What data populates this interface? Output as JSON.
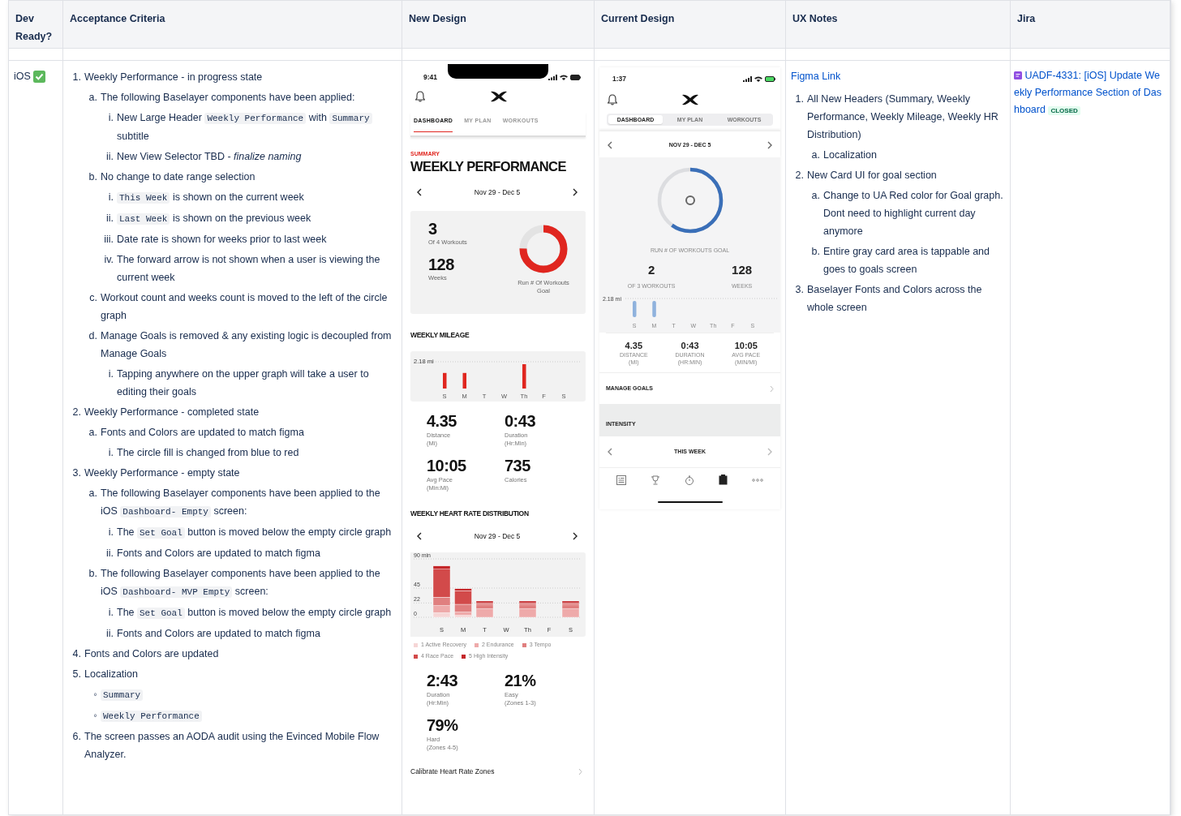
{
  "table": {
    "columns": [
      "Dev Ready?",
      "Acceptance Criteria",
      "New Design",
      "Current Design",
      "UX Notes",
      "Jira"
    ],
    "row": {
      "platform": "iOS",
      "ready": true,
      "criteria": [
        {
          "marker": "1.",
          "text": "Weekly Performance - in progress state",
          "children": [
            {
              "marker": "a.",
              "text": "The following Baselayer components have been applied:",
              "children": [
                {
                  "marker": "i.",
                  "parts": [
                    {
                      "kind": "plain",
                      "text": "New Large Header "
                    },
                    {
                      "kind": "code",
                      "text": "Weekly Performance"
                    },
                    {
                      "kind": "plain",
                      "text": " with "
                    },
                    {
                      "kind": "code",
                      "text": "Summary"
                    },
                    {
                      "kind": "plain",
                      "text": " subtitle"
                    }
                  ]
                },
                {
                  "marker": "ii.",
                  "parts": [
                    {
                      "kind": "plain",
                      "text": "New View Selector TBD -  "
                    },
                    {
                      "kind": "italic",
                      "text": "finalize naming"
                    }
                  ]
                }
              ]
            },
            {
              "marker": "b.",
              "text": "No change to date range selection",
              "children": [
                {
                  "marker": "i.",
                  "parts": [
                    {
                      "kind": "code",
                      "text": "This Week"
                    },
                    {
                      "kind": "plain",
                      "text": " is shown on the current week"
                    }
                  ]
                },
                {
                  "marker": "ii.",
                  "parts": [
                    {
                      "kind": "code",
                      "text": "Last Week"
                    },
                    {
                      "kind": "plain",
                      "text": " is shown on the previous week"
                    }
                  ]
                },
                {
                  "marker": "iii.",
                  "text": "Date rate is shown for weeks prior to last week"
                },
                {
                  "marker": "iv.",
                  "text": "The forward arrow is not shown when a user is viewing the current week"
                }
              ]
            },
            {
              "marker": "c.",
              "text": "Workout count and weeks count is moved to the left of the circle graph"
            },
            {
              "marker": "d.",
              "text": "Manage Goals is removed & any existing logic is decoupled from Manage Goals",
              "children": [
                {
                  "marker": "i.",
                  "text": "Tapping anywhere on the upper graph will take a user to editing their goals"
                }
              ]
            }
          ]
        },
        {
          "marker": "2.",
          "text": "Weekly Performance - completed state",
          "children": [
            {
              "marker": "a.",
              "text": "Fonts and Colors are updated to match figma",
              "children": [
                {
                  "marker": "i.",
                  "text": "The circle fill is changed from blue to red"
                }
              ]
            }
          ]
        },
        {
          "marker": "3.",
          "text": "Weekly Performance - empty state",
          "children": [
            {
              "marker": "a.",
              "parts": [
                {
                  "kind": "plain",
                  "text": "The following Baselayer components have been applied to the iOS "
                },
                {
                  "kind": "code",
                  "text": "Dashboard- Empty"
                },
                {
                  "kind": "plain",
                  "text": " screen:"
                }
              ],
              "children": [
                {
                  "marker": "i.",
                  "parts": [
                    {
                      "kind": "plain",
                      "text": "The "
                    },
                    {
                      "kind": "code",
                      "text": "Set Goal"
                    },
                    {
                      "kind": "plain",
                      "text": " button is moved below the empty circle graph"
                    }
                  ]
                },
                {
                  "marker": "ii.",
                  "text": "Fonts and Colors are updated to match figma"
                }
              ]
            },
            {
              "marker": "b.",
              "parts": [
                {
                  "kind": "plain",
                  "text": "The following Baselayer components have been applied to the iOS "
                },
                {
                  "kind": "code",
                  "text": "Dashboard- MVP Empty"
                },
                {
                  "kind": "plain",
                  "text": " screen:"
                }
              ],
              "children": [
                {
                  "marker": "i.",
                  "parts": [
                    {
                      "kind": "plain",
                      "text": "The "
                    },
                    {
                      "kind": "code",
                      "text": "Set Goal"
                    },
                    {
                      "kind": "plain",
                      "text": " button is moved below the empty circle graph"
                    }
                  ]
                },
                {
                  "marker": "ii.",
                  "text": "Fonts and Colors are updated to match figma"
                }
              ]
            }
          ]
        },
        {
          "marker": "4.",
          "text": "Fonts and Colors are updated"
        },
        {
          "marker": "5.",
          "text": "Localization",
          "children": [
            {
              "marker": "◦",
              "parts": [
                {
                  "kind": "code",
                  "text": "Summary"
                }
              ]
            },
            {
              "marker": "◦",
              "parts": [
                {
                  "kind": "code",
                  "text": "Weekly Performance"
                }
              ]
            }
          ]
        },
        {
          "marker": "6.",
          "text": "The screen passes an AODA audit using the Evinced Mobile Flow Analyzer."
        }
      ],
      "new_design": {
        "time": "9:41",
        "tabs": [
          {
            "label": "DASHBOARD",
            "selected": true
          },
          {
            "label": "MY PLAN",
            "selected": false
          },
          {
            "label": "WORKOUTS",
            "selected": false
          }
        ],
        "eyebrow": "SUMMARY",
        "title": "WEEKLY PERFORMANCE",
        "date_range": "Nov 29 - Dec 5",
        "goal": {
          "stats": [
            {
              "value": "3",
              "label": "Of 4 Workouts"
            },
            {
              "value": "128",
              "label": "Weeks"
            }
          ],
          "level": 0.75,
          "caption": "Run # Of Workouts Goal"
        },
        "mileage": {
          "title": "WEEKLY MILEAGE",
          "axis_label": "2.18 mi",
          "days": [
            "S",
            "M",
            "T",
            "W",
            "Th",
            "F",
            "S"
          ]
        },
        "stats": [
          {
            "value": "4.35",
            "label": "Distance",
            "unit": "(Mi)"
          },
          {
            "value": "0:43",
            "label": "Duration",
            "unit": "(Hr:Min)"
          },
          {
            "value": "10:05",
            "label": "Avg Pace",
            "unit": "(Min:Mi)"
          },
          {
            "value": "735",
            "label": "Calories"
          }
        ],
        "heart_rate": {
          "title": "WEEKLY HEART RATE DISTRIBUTION",
          "date_range": "Nov 29 - Dec 5",
          "chart_data": {
            "type": "bar",
            "stacked": true,
            "categories": [
              "S",
              "M",
              "T",
              "W",
              "Th",
              "F",
              "S"
            ],
            "ylim": [
              0,
              90
            ],
            "yticks": [
              {
                "value": 0,
                "label": "0"
              },
              {
                "value": 22,
                "label": "22"
              },
              {
                "value": 45,
                "label": "45"
              },
              {
                "value": 90,
                "label": "90 min"
              }
            ],
            "series": [
              {
                "name": "1 Active Recovery",
                "color": "#f6d6d6",
                "values": [
                  7,
                  3,
                  0,
                  0,
                  0,
                  0,
                  0
                ]
              },
              {
                "name": "2 Endurance",
                "color": "#eeaaaa",
                "values": [
                  11,
                  5,
                  13,
                  0,
                  13,
                  0,
                  13
                ]
              },
              {
                "name": "3 Tempo",
                "color": "#e07f7f",
                "values": [
                  13,
                  12,
                  7,
                  0,
                  7,
                  0,
                  7
                ]
              },
              {
                "name": "4 Race Pace",
                "color": "#d24a4a",
                "values": [
                  43,
                  21,
                  2,
                  0,
                  2,
                  0,
                  2
                ]
              },
              {
                "name": "5 High Intensity",
                "color": "#c4272a",
                "values": [
                  5,
                  3,
                  3,
                  0,
                  3,
                  0,
                  3
                ]
              }
            ]
          }
        },
        "hr_stats": [
          {
            "value": "2:43",
            "label": "Duration",
            "unit": "(Hr:Min)"
          },
          {
            "value": "21%",
            "label": "Easy",
            "unit": "(Zones 1-3)"
          },
          {
            "value": "79%",
            "label": "Hard",
            "unit": "(Zones 4-5)"
          }
        ],
        "calibrate": "Calibrate Heart Rate Zones"
      },
      "current_design": {
        "time": "1:37",
        "tabs": [
          {
            "label": "DASHBOARD",
            "selected": true
          },
          {
            "label": "MY PLAN",
            "selected": false
          },
          {
            "label": "WORKOUTS",
            "selected": false
          }
        ],
        "date_range": "NOV 29 - DEC 5",
        "level": 0.6,
        "caption": "RUN # OF WORKOUTS GOAL",
        "goal_stats": [
          {
            "value": "2",
            "label": "OF 3 WORKOUTS"
          },
          {
            "value": "128",
            "label": "WEEKS"
          }
        ],
        "mileage": {
          "axis_label": "2.18 mi",
          "days": [
            "S",
            "M",
            "T",
            "W",
            "Th",
            "F",
            "S"
          ]
        },
        "stats": [
          {
            "value": "4.35",
            "label": "DISTANCE",
            "unit": "(MI)"
          },
          {
            "value": "0:43",
            "label": "DURATION",
            "unit": "(HR:MIN)"
          },
          {
            "value": "10:05",
            "label": "AVG PACE",
            "unit": "(MIN/MI)"
          }
        ],
        "manage_goals": "MANAGE GOALS",
        "intensity": "INTENSITY",
        "week": "THIS WEEK"
      },
      "ux_notes": {
        "link": "Figma Link",
        "items": [
          {
            "marker": "1.",
            "text": "All New Headers (Summary, Weekly Performance, Weekly Mileage, Weekly HR Distribution)",
            "children": [
              {
                "marker": "a.",
                "text": "Localization"
              }
            ]
          },
          {
            "marker": "2.",
            "text": "New Card UI for goal section",
            "children": [
              {
                "marker": "a.",
                "text": "Change to  UA Red color for Goal graph. Dont need to highlight current day anymore"
              },
              {
                "marker": "b.",
                "text": "Entire gray card area is tappable and goes to goals screen"
              }
            ]
          },
          {
            "marker": "3.",
            "text": "Baselayer Fonts and Colors across the whole screen"
          }
        ]
      },
      "jira": {
        "issue": "UADF-4331: [iOS] Update Weekly Performance Section of Dashboard",
        "status": "CLOSED"
      }
    }
  }
}
